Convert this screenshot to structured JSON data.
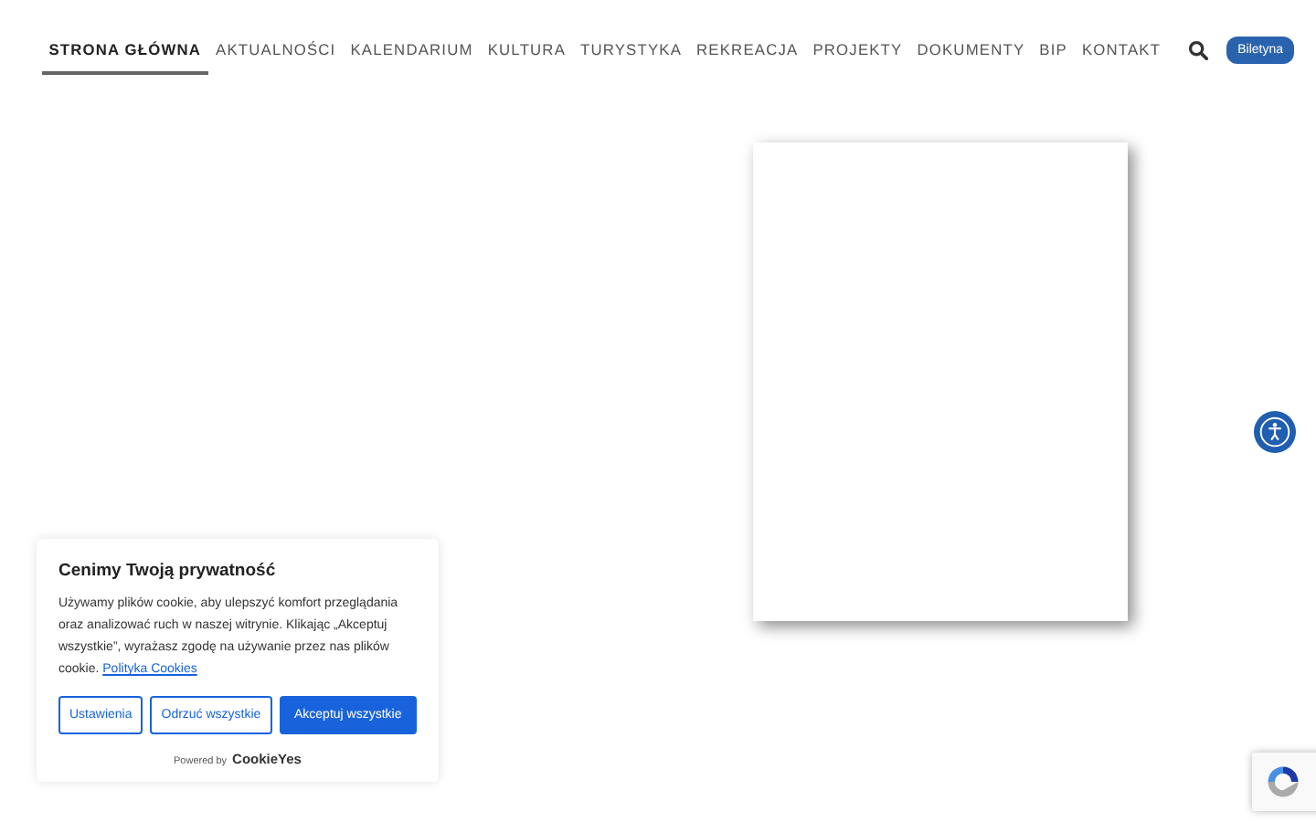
{
  "nav": {
    "items": [
      {
        "label": "STRONA GŁÓWNA",
        "selected": true
      },
      {
        "label": "AKTUALNOŚCI",
        "selected": false
      },
      {
        "label": "KALENDARIUM",
        "selected": false
      },
      {
        "label": "KULTURA",
        "selected": false
      },
      {
        "label": "TURYSTYKA",
        "selected": false
      },
      {
        "label": "REKREACJA",
        "selected": false
      },
      {
        "label": "PROJEKTY",
        "selected": false
      },
      {
        "label": "DOKUMENTY",
        "selected": false
      },
      {
        "label": "BIP",
        "selected": false
      },
      {
        "label": "KONTAKT",
        "selected": false
      }
    ],
    "button": "Biletyna"
  },
  "cookie_banner": {
    "title": "Cenimy Twoją prywatność",
    "text": "Używamy plików cookie, aby ulepszyć komfort przeglądania oraz analizować ruch w naszej witrynie. Klikając „Akceptuj wszystkie”, wyrażasz zgodę na używanie przez nas plików cookie.",
    "link": "Polityka Cookies",
    "buttons": [
      {
        "label": "Ustawienia",
        "kind": "outline"
      },
      {
        "label": "Odrzuć wszystkie",
        "kind": "outline"
      },
      {
        "label": "Akceptuj wszystkie",
        "kind": "primary"
      }
    ],
    "powered_by": "Powered by",
    "brand": "CookieYes"
  }
}
